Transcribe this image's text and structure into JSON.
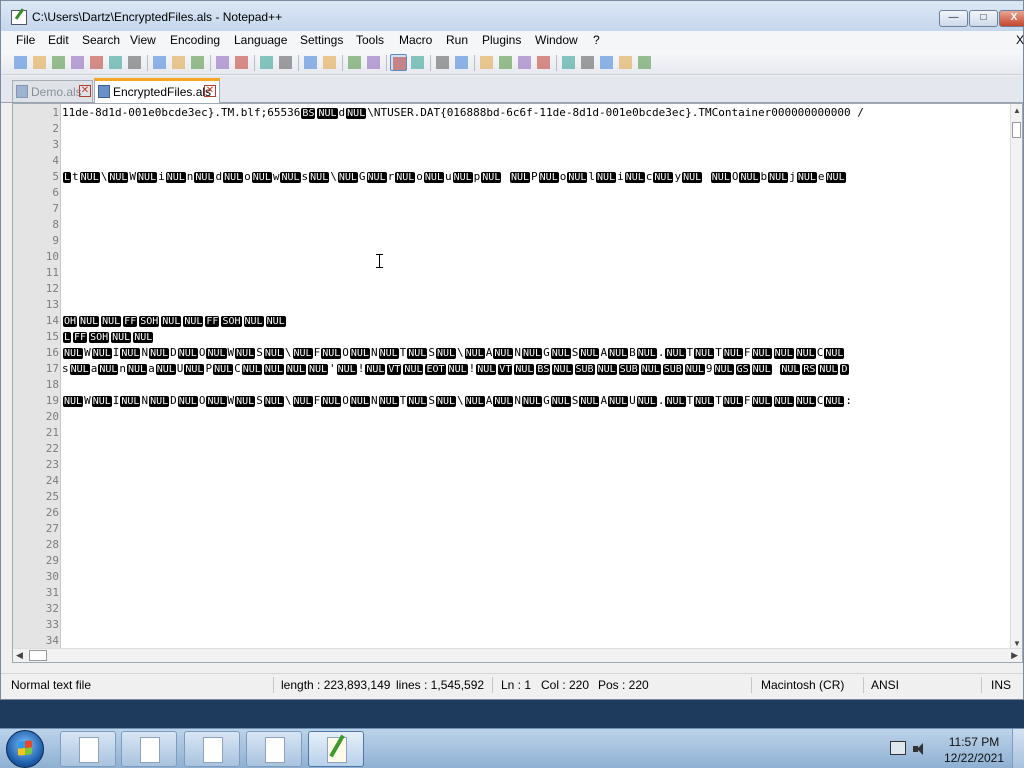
{
  "window": {
    "title": "C:\\Users\\Dartz\\EncryptedFiles.als - Notepad++",
    "min_label": "—",
    "max_label": "□",
    "close_label": "X"
  },
  "menu": [
    "File",
    "Edit",
    "Search",
    "View",
    "Encoding",
    "Language",
    "Settings",
    "Tools",
    "Macro",
    "Run",
    "Plugins",
    "Window",
    "?"
  ],
  "menu_close": "X",
  "toolbar_icons": [
    "new-file-icon",
    "open-file-icon",
    "save-icon",
    "save-all-icon",
    "close-icon",
    "close-all-icon",
    "print-icon",
    "cut-icon",
    "copy-icon",
    "paste-icon",
    "undo-icon",
    "redo-icon",
    "find-icon",
    "replace-icon",
    "zoom-in-icon",
    "zoom-out-icon",
    "sync-vertical-icon",
    "sync-horizontal-icon",
    "word-wrap-icon",
    "show-all-chars-icon",
    "indent-guide-icon",
    "user-defined-lang-icon",
    "doc-map-icon",
    "function-list-icon",
    "folder-workspace-icon",
    "monitoring-icon",
    "record-macro-icon",
    "stop-record-icon",
    "playback-macro-icon",
    "run-macro-multiple-icon",
    "save-macro-icon"
  ],
  "tabs": [
    {
      "label": "Demo.als",
      "active": false
    },
    {
      "label": "EncryptedFiles.als",
      "active": true
    }
  ],
  "editor": {
    "line_numbers": [
      "1",
      "2",
      "3",
      "4",
      "5",
      "6",
      "7",
      "8",
      "9",
      "10",
      "11",
      "12",
      "13",
      "14",
      "15",
      "16",
      "17",
      "18",
      "19",
      "20",
      "21",
      "22",
      "23",
      "24",
      "25",
      "26",
      "27",
      "28",
      "29",
      "30",
      "31",
      "32",
      "33",
      "34"
    ],
    "lines": [
      {
        "n": 1,
        "segs": [
          [
            "t",
            "11de-8d1d-001e0bcde3ec}.TM.blf;65536"
          ],
          [
            "c",
            "BS"
          ],
          [
            "c",
            "NUL"
          ],
          [
            "t",
            "d"
          ],
          [
            "c",
            "NUL"
          ],
          [
            "t",
            "\\NTUSER.DAT{016888bd-6c6f-11de-8d1d-001e0bcde3ec}.TMContainer000000000000 /"
          ]
        ]
      },
      {
        "n": 5,
        "segs": [
          [
            "c",
            "L"
          ],
          [
            "t",
            "t"
          ],
          [
            "c",
            "NUL"
          ],
          [
            "t",
            "\\"
          ],
          [
            "c",
            "NUL"
          ],
          [
            "t",
            "W"
          ],
          [
            "c",
            "NUL"
          ],
          [
            "t",
            "i"
          ],
          [
            "c",
            "NUL"
          ],
          [
            "t",
            "n"
          ],
          [
            "c",
            "NUL"
          ],
          [
            "t",
            "d"
          ],
          [
            "c",
            "NUL"
          ],
          [
            "t",
            "o"
          ],
          [
            "c",
            "NUL"
          ],
          [
            "t",
            "w"
          ],
          [
            "c",
            "NUL"
          ],
          [
            "t",
            "s"
          ],
          [
            "c",
            "NUL"
          ],
          [
            "t",
            "\\"
          ],
          [
            "c",
            "NUL"
          ],
          [
            "t",
            "G"
          ],
          [
            "c",
            "NUL"
          ],
          [
            "t",
            "r"
          ],
          [
            "c",
            "NUL"
          ],
          [
            "t",
            "o"
          ],
          [
            "c",
            "NUL"
          ],
          [
            "t",
            "u"
          ],
          [
            "c",
            "NUL"
          ],
          [
            "t",
            "p"
          ],
          [
            "c",
            "NUL"
          ],
          [
            "t",
            " "
          ],
          [
            "c",
            "NUL"
          ],
          [
            "t",
            "P"
          ],
          [
            "c",
            "NUL"
          ],
          [
            "t",
            "o"
          ],
          [
            "c",
            "NUL"
          ],
          [
            "t",
            "l"
          ],
          [
            "c",
            "NUL"
          ],
          [
            "t",
            "i"
          ],
          [
            "c",
            "NUL"
          ],
          [
            "t",
            "c"
          ],
          [
            "c",
            "NUL"
          ],
          [
            "t",
            "y"
          ],
          [
            "c",
            "NUL"
          ],
          [
            "t",
            " "
          ],
          [
            "c",
            "NUL"
          ],
          [
            "t",
            "O"
          ],
          [
            "c",
            "NUL"
          ],
          [
            "t",
            "b"
          ],
          [
            "c",
            "NUL"
          ],
          [
            "t",
            "j"
          ],
          [
            "c",
            "NUL"
          ],
          [
            "t",
            "e"
          ],
          [
            "c",
            "NUL"
          ]
        ]
      },
      {
        "n": 14,
        "segs": [
          [
            "c",
            "OH"
          ],
          [
            "c",
            "NUL"
          ],
          [
            "c",
            "NUL"
          ],
          [
            "c",
            "FF"
          ],
          [
            "c",
            "SOH"
          ],
          [
            "c",
            "NUL"
          ],
          [
            "c",
            "NUL"
          ],
          [
            "c",
            "FF"
          ],
          [
            "c",
            "SOH"
          ],
          [
            "c",
            "NUL"
          ],
          [
            "c",
            "NUL"
          ]
        ]
      },
      {
        "n": 15,
        "segs": [
          [
            "c",
            "L"
          ],
          [
            "c",
            "FF"
          ],
          [
            "c",
            "SOH"
          ],
          [
            "c",
            "NUL"
          ],
          [
            "c",
            "NUL"
          ]
        ]
      },
      {
        "n": 16,
        "segs": [
          [
            "c",
            "NUL"
          ],
          [
            "t",
            "W"
          ],
          [
            "c",
            "NUL"
          ],
          [
            "t",
            "I"
          ],
          [
            "c",
            "NUL"
          ],
          [
            "t",
            "N"
          ],
          [
            "c",
            "NUL"
          ],
          [
            "t",
            "D"
          ],
          [
            "c",
            "NUL"
          ],
          [
            "t",
            "O"
          ],
          [
            "c",
            "NUL"
          ],
          [
            "t",
            "W"
          ],
          [
            "c",
            "NUL"
          ],
          [
            "t",
            "S"
          ],
          [
            "c",
            "NUL"
          ],
          [
            "t",
            "\\"
          ],
          [
            "c",
            "NUL"
          ],
          [
            "t",
            "F"
          ],
          [
            "c",
            "NUL"
          ],
          [
            "t",
            "O"
          ],
          [
            "c",
            "NUL"
          ],
          [
            "t",
            "N"
          ],
          [
            "c",
            "NUL"
          ],
          [
            "t",
            "T"
          ],
          [
            "c",
            "NUL"
          ],
          [
            "t",
            "S"
          ],
          [
            "c",
            "NUL"
          ],
          [
            "t",
            "\\"
          ],
          [
            "c",
            "NUL"
          ],
          [
            "t",
            "A"
          ],
          [
            "c",
            "NUL"
          ],
          [
            "t",
            "N"
          ],
          [
            "c",
            "NUL"
          ],
          [
            "t",
            "G"
          ],
          [
            "c",
            "NUL"
          ],
          [
            "t",
            "S"
          ],
          [
            "c",
            "NUL"
          ],
          [
            "t",
            "A"
          ],
          [
            "c",
            "NUL"
          ],
          [
            "t",
            "B"
          ],
          [
            "c",
            "NUL"
          ],
          [
            "t",
            "."
          ],
          [
            "c",
            "NUL"
          ],
          [
            "t",
            "T"
          ],
          [
            "c",
            "NUL"
          ],
          [
            "t",
            "T"
          ],
          [
            "c",
            "NUL"
          ],
          [
            "t",
            "F"
          ],
          [
            "c",
            "NUL"
          ],
          [
            "c",
            "NUL"
          ],
          [
            "c",
            "NUL"
          ],
          [
            "t",
            "C"
          ],
          [
            "c",
            "NUL"
          ]
        ]
      },
      {
        "n": 17,
        "segs": [
          [
            "t",
            "s"
          ],
          [
            "c",
            "NUL"
          ],
          [
            "t",
            "a"
          ],
          [
            "c",
            "NUL"
          ],
          [
            "t",
            "n"
          ],
          [
            "c",
            "NUL"
          ],
          [
            "t",
            "a"
          ],
          [
            "c",
            "NUL"
          ],
          [
            "t",
            "U"
          ],
          [
            "c",
            "NUL"
          ],
          [
            "t",
            "P"
          ],
          [
            "c",
            "NUL"
          ],
          [
            "t",
            "C"
          ],
          [
            "c",
            "NUL"
          ],
          [
            "c",
            "NUL"
          ],
          [
            "c",
            "NUL"
          ],
          [
            "c",
            "NUL"
          ],
          [
            "t",
            "'"
          ],
          [
            "c",
            "NUL"
          ],
          [
            "t",
            "!"
          ],
          [
            "c",
            "NUL"
          ],
          [
            "c",
            "VT"
          ],
          [
            "c",
            "NUL"
          ],
          [
            "c",
            "EOT"
          ],
          [
            "c",
            "NUL"
          ],
          [
            "t",
            "!"
          ],
          [
            "c",
            "NUL"
          ],
          [
            "c",
            "VT"
          ],
          [
            "c",
            "NUL"
          ],
          [
            "c",
            "BS"
          ],
          [
            "c",
            "NUL"
          ],
          [
            "c",
            "SUB"
          ],
          [
            "c",
            "NUL"
          ],
          [
            "c",
            "SUB"
          ],
          [
            "c",
            "NUL"
          ],
          [
            "c",
            "SUB"
          ],
          [
            "c",
            "NUL"
          ],
          [
            "t",
            "9"
          ],
          [
            "c",
            "NUL"
          ],
          [
            "c",
            "GS"
          ],
          [
            "c",
            "NUL"
          ],
          [
            "t",
            " "
          ],
          [
            "c",
            "NUL"
          ],
          [
            "c",
            "RS"
          ],
          [
            "c",
            "NUL"
          ],
          [
            "c",
            "D"
          ]
        ]
      },
      {
        "n": 19,
        "segs": [
          [
            "c",
            "NUL"
          ],
          [
            "t",
            "W"
          ],
          [
            "c",
            "NUL"
          ],
          [
            "t",
            "I"
          ],
          [
            "c",
            "NUL"
          ],
          [
            "t",
            "N"
          ],
          [
            "c",
            "NUL"
          ],
          [
            "t",
            "D"
          ],
          [
            "c",
            "NUL"
          ],
          [
            "t",
            "O"
          ],
          [
            "c",
            "NUL"
          ],
          [
            "t",
            "W"
          ],
          [
            "c",
            "NUL"
          ],
          [
            "t",
            "S"
          ],
          [
            "c",
            "NUL"
          ],
          [
            "t",
            "\\"
          ],
          [
            "c",
            "NUL"
          ],
          [
            "t",
            "F"
          ],
          [
            "c",
            "NUL"
          ],
          [
            "t",
            "O"
          ],
          [
            "c",
            "NUL"
          ],
          [
            "t",
            "N"
          ],
          [
            "c",
            "NUL"
          ],
          [
            "t",
            "T"
          ],
          [
            "c",
            "NUL"
          ],
          [
            "t",
            "S"
          ],
          [
            "c",
            "NUL"
          ],
          [
            "t",
            "\\"
          ],
          [
            "c",
            "NUL"
          ],
          [
            "t",
            "A"
          ],
          [
            "c",
            "NUL"
          ],
          [
            "t",
            "N"
          ],
          [
            "c",
            "NUL"
          ],
          [
            "t",
            "G"
          ],
          [
            "c",
            "NUL"
          ],
          [
            "t",
            "S"
          ],
          [
            "c",
            "NUL"
          ],
          [
            "t",
            "A"
          ],
          [
            "c",
            "NUL"
          ],
          [
            "t",
            "U"
          ],
          [
            "c",
            "NUL"
          ],
          [
            "t",
            "."
          ],
          [
            "c",
            "NUL"
          ],
          [
            "t",
            "T"
          ],
          [
            "c",
            "NUL"
          ],
          [
            "t",
            "T"
          ],
          [
            "c",
            "NUL"
          ],
          [
            "t",
            "F"
          ],
          [
            "c",
            "NUL"
          ],
          [
            "c",
            "NUL"
          ],
          [
            "c",
            "NUL"
          ],
          [
            "t",
            "C"
          ],
          [
            "c",
            "NUL"
          ],
          [
            "t",
            ":"
          ]
        ]
      }
    ]
  },
  "status": {
    "file_type": "Normal text file",
    "length": "length : 223,893,149",
    "lines": "lines : 1,545,592",
    "ln": "Ln : 1",
    "col": "Col : 220",
    "pos": "Pos : 220",
    "eol": "Macintosh (CR)",
    "encoding": "ANSI",
    "mode": "INS"
  },
  "taskbar": {
    "buttons": [
      "document-icon",
      "document-icon",
      "document-icon",
      "document-icon",
      "notepad-plus-plus-icon"
    ],
    "time": "11:57 PM",
    "date": "12/22/2021"
  },
  "colors": {
    "accent_tab": "#f5a623",
    "control_char_bg": "#000000"
  }
}
